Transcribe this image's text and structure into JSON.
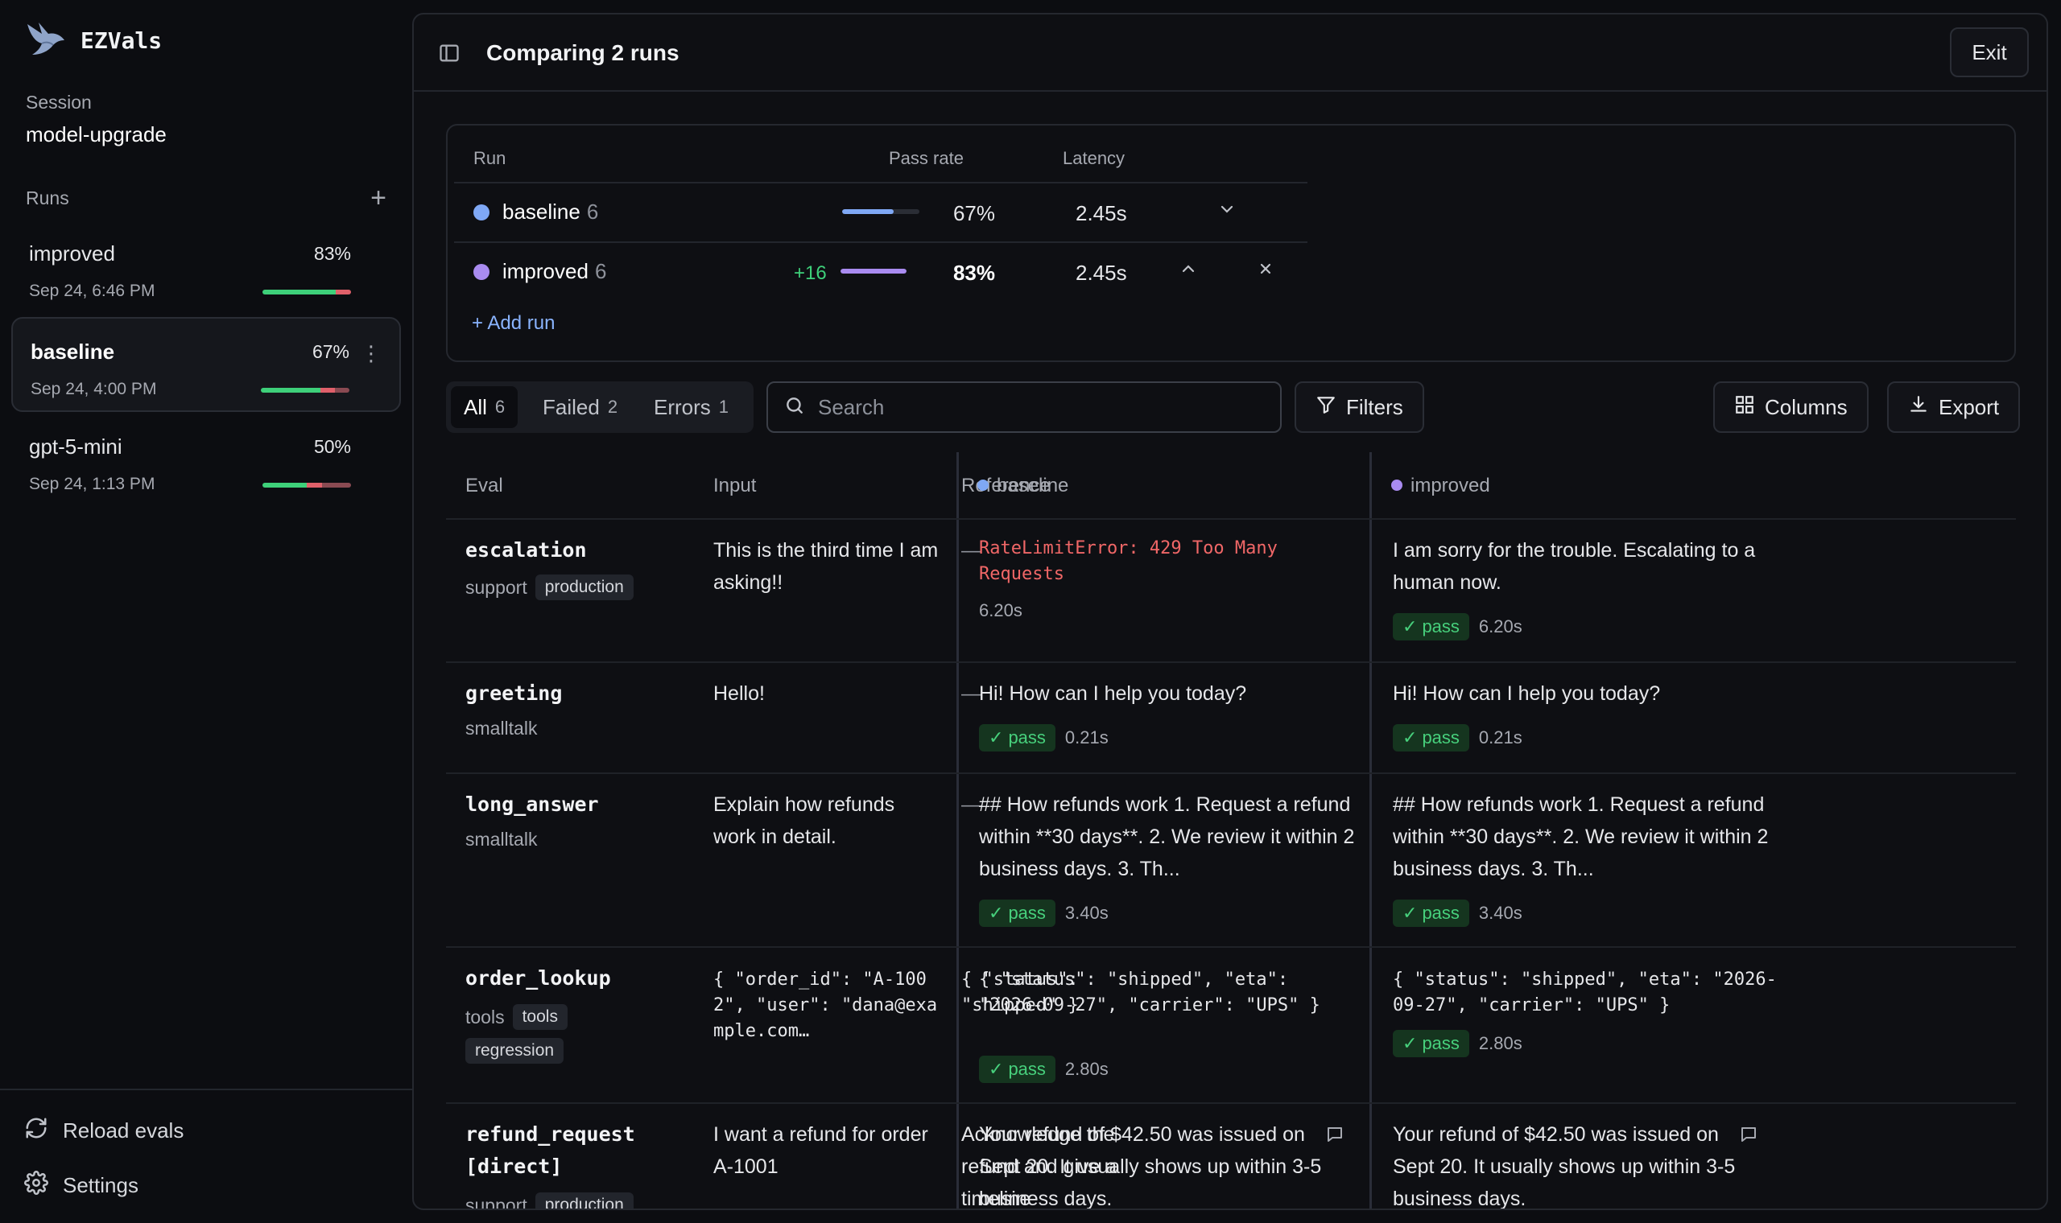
{
  "app": {
    "name": "EZVals"
  },
  "session": {
    "label": "Session",
    "name": "model-upgrade"
  },
  "runs": {
    "label": "Runs",
    "add_icon": "plus-icon",
    "items": [
      {
        "name": "improved",
        "pct": "83%",
        "date": "Sep 24, 6:46 PM",
        "pass_fraction": 0.83
      },
      {
        "name": "baseline",
        "pct": "67%",
        "date": "Sep 24, 4:00 PM",
        "pass_fraction": 0.67
      },
      {
        "name": "gpt-5-mini",
        "pct": "50%",
        "date": "Sep 24, 1:13 PM",
        "pass_fraction": 0.5
      }
    ]
  },
  "sidebar_actions": {
    "reload": "Reload evals",
    "settings": "Settings"
  },
  "topbar": {
    "title": "Comparing 2 runs",
    "exit": "Exit"
  },
  "compare": {
    "headers": {
      "run": "Run",
      "pass_rate": "Pass rate",
      "latency": "Latency"
    },
    "rows": [
      {
        "name": "baseline",
        "count": "6",
        "delta": "",
        "pct": "67%",
        "pass_fraction": 0.67,
        "latency": "2.45s",
        "color": "#7fa8f5"
      },
      {
        "name": "improved",
        "count": "6",
        "delta": "+16",
        "pct": "83%",
        "pass_fraction": 0.83,
        "latency": "2.45s",
        "color": "#a98bf0"
      }
    ],
    "add_run": "+ Add run"
  },
  "filters": {
    "tabs": [
      {
        "label": "All",
        "count": "6"
      },
      {
        "label": "Failed",
        "count": "2"
      },
      {
        "label": "Errors",
        "count": "1"
      }
    ],
    "search_placeholder": "Search",
    "filters_label": "Filters",
    "columns_label": "Columns",
    "export_label": "Export"
  },
  "table": {
    "headers": {
      "eval": "Eval",
      "input": "Input",
      "reference": "Reference",
      "baseline": "baseline",
      "improved": "improved"
    },
    "rows": [
      {
        "eval": "escalation",
        "dataset": "support",
        "tags": [
          "production"
        ],
        "input": "This is the third time I am asking!!",
        "reference": "—",
        "baseline": {
          "output": "RateLimitError: 429 Too Many Requests",
          "status": "",
          "latency": "6.20s"
        },
        "improved": {
          "output": "I am sorry for the trouble. Escalating to a human now.",
          "status": "pass",
          "latency": "6.20s"
        }
      },
      {
        "eval": "greeting",
        "dataset": "smalltalk",
        "tags": [],
        "input": "Hello!",
        "reference": "—",
        "baseline": {
          "output": "Hi! How can I help you today?",
          "status": "pass",
          "latency": "0.21s"
        },
        "improved": {
          "output": "Hi! How can I help you today?",
          "status": "pass",
          "latency": "0.21s"
        }
      },
      {
        "eval": "long_answer",
        "dataset": "smalltalk",
        "tags": [],
        "input": "Explain how refunds work in detail.",
        "reference": "—",
        "baseline": {
          "output": "## How refunds work 1. Request a refund within **30 days**. 2. We review it within 2 business days. 3. Th...",
          "status": "pass",
          "latency": "3.40s"
        },
        "improved": {
          "output": "## How refunds work 1. Request a refund within **30 days**. 2. We review it within 2 business days. 3. Th...",
          "status": "pass",
          "latency": "3.40s"
        }
      },
      {
        "eval": "order_lookup",
        "dataset": "tools",
        "tags": [
          "tools",
          "regression"
        ],
        "input": "{ \"order_id\": \"A-1002\", \"user\": \"dana@example.com…",
        "reference": "{ \"status\": \"shipped\" }",
        "baseline": {
          "output": "{ \"status\": \"shipped\", \"eta\": \"2026-09-27\", \"carrier\": \"UPS\" }",
          "status": "pass",
          "latency": "2.80s"
        },
        "improved": {
          "output": "{ \"status\": \"shipped\", \"eta\": \"2026-09-27\", \"carrier\": \"UPS\" }",
          "status": "pass",
          "latency": "2.80s"
        }
      },
      {
        "eval": "refund_request [direct]",
        "dataset": "support",
        "tags": [
          "production"
        ],
        "input": "I want a refund for order A-1001",
        "reference": "Acknowledge the refund and give a timeline",
        "baseline": {
          "output": "Your refund of $42.50 was issued on Sept 20. It usually shows up within 3-5 business days.",
          "status": "",
          "latency": ""
        },
        "improved": {
          "output": "Your refund of $42.50 was issued on Sept 20. It usually shows up within 3-5 business days.",
          "status": "",
          "latency": ""
        }
      }
    ]
  },
  "colors": {
    "pass_green": "#3ed07a",
    "fail_red": "#e0606a",
    "error_red": "#f06767",
    "baseline_blue": "#7fa8f5",
    "improved_purple": "#a98bf0"
  }
}
